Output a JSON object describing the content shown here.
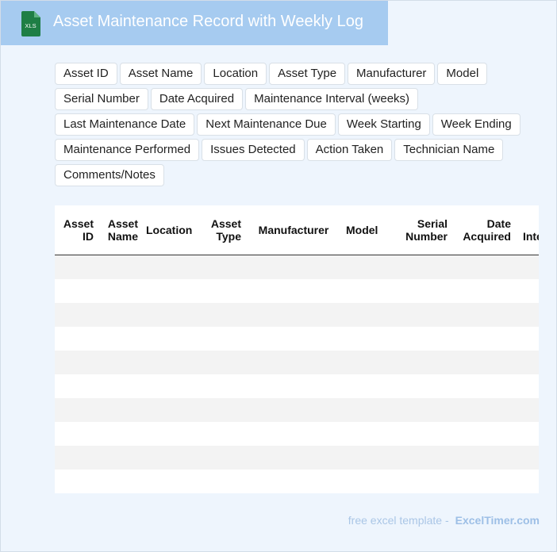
{
  "header": {
    "icon_text": "XLS",
    "title": "Asset Maintenance Record with Weekly Log"
  },
  "tags": [
    "Asset ID",
    "Asset Name",
    "Location",
    "Asset Type",
    "Manufacturer",
    "Model",
    "Serial Number",
    "Date Acquired",
    "Maintenance Interval (weeks)",
    "Last Maintenance Date",
    "Next Maintenance Due",
    "Week Starting",
    "Week Ending",
    "Maintenance Performed",
    "Issues Detected",
    "Action Taken",
    "Technician Name",
    "Comments/Notes"
  ],
  "table": {
    "columns": [
      "Asset ID",
      "Asset Name",
      "Location",
      "Asset Type",
      "Manufacturer",
      "Model",
      "Serial Number",
      "Date Acquired",
      "Maintenance Interval (weeks)"
    ],
    "row_count": 10
  },
  "footer": {
    "text": "free excel template -",
    "brand": "ExcelTimer.com"
  },
  "colors": {
    "header_bg": "#a6cbf0",
    "page_bg": "#eef5fd",
    "icon_green": "#1e7e45",
    "row_stripe": "#f3f3f3"
  }
}
